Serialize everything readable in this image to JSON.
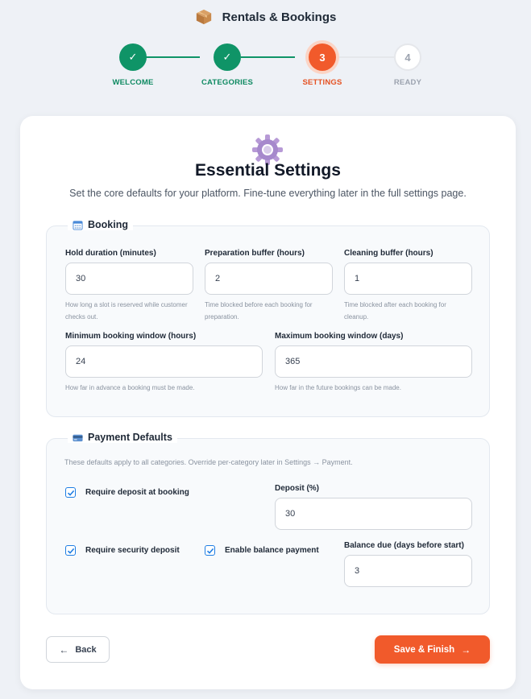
{
  "app": {
    "title": "Rentals & Bookings",
    "icon": "package-icon"
  },
  "stepper": {
    "steps": [
      {
        "marker": "✓",
        "label": "WELCOME",
        "state": "done"
      },
      {
        "marker": "✓",
        "label": "CATEGORIES",
        "state": "done"
      },
      {
        "marker": "3",
        "label": "SETTINGS",
        "state": "current"
      },
      {
        "marker": "4",
        "label": "READY",
        "state": "pending"
      }
    ]
  },
  "page": {
    "icon": "gear-icon",
    "title": "Essential Settings",
    "subtitle": "Set the core defaults for your platform. Fine-tune everything later in the full settings page."
  },
  "booking": {
    "legend": "Booking",
    "icon": "calendar-icon",
    "hold_duration": {
      "label": "Hold duration (minutes)",
      "value": "30",
      "hint": "How long a slot is reserved while customer checks out."
    },
    "prep_buffer": {
      "label": "Preparation buffer (hours)",
      "value": "2",
      "hint": "Time blocked before each booking for preparation."
    },
    "cleaning_buffer": {
      "label": "Cleaning buffer (hours)",
      "value": "1",
      "hint": "Time blocked after each booking for cleanup."
    },
    "min_window": {
      "label": "Minimum booking window (hours)",
      "value": "24",
      "hint": "How far in advance a booking must be made."
    },
    "max_window": {
      "label": "Maximum booking window (days)",
      "value": "365",
      "hint": "How far in the future bookings can be made."
    }
  },
  "payment": {
    "legend": "Payment Defaults",
    "icon": "credit-card-icon",
    "note": "These defaults apply to all categories. Override per-category later in Settings → Payment.",
    "require_deposit": {
      "label": "Require deposit at booking",
      "checked": true
    },
    "deposit_percent": {
      "label": "Deposit (%)",
      "value": "30"
    },
    "require_security": {
      "label": "Require security deposit",
      "checked": true
    },
    "enable_balance": {
      "label": "Enable balance payment",
      "checked": true
    },
    "balance_due": {
      "label": "Balance due (days before start)",
      "value": "3"
    }
  },
  "actions": {
    "back_label": "Back",
    "finish_label": "Save & Finish"
  },
  "colors": {
    "accent": "#f15a2b",
    "success": "#0f9467",
    "checkbox": "#1e7de3"
  }
}
